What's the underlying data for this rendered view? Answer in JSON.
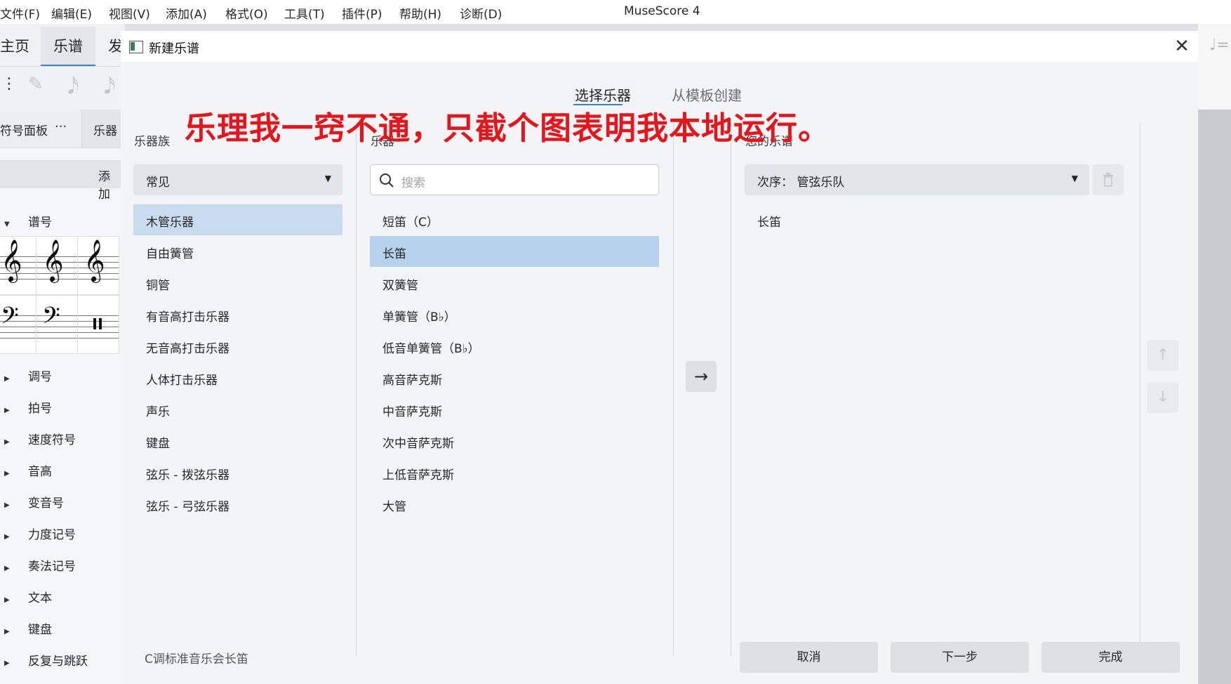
{
  "app": {
    "title": "MuseScore 4",
    "menu": [
      "文件(F)",
      "编辑(E)",
      "视图(V)",
      "添加(A)",
      "格式(O)",
      "工具(T)",
      "插件(P)",
      "帮助(H)",
      "诊断(D)"
    ]
  },
  "tabs": [
    "主页",
    "乐谱",
    "发"
  ],
  "palette": {
    "tab_label": "符号面板",
    "more": "···",
    "instruments_tab": "乐器",
    "add_label": "添加",
    "sections": [
      "谱号",
      "调号",
      "拍号",
      "速度符号",
      "音高",
      "变音号",
      "力度记号",
      "奏法记号",
      "文本",
      "键盘",
      "反复与跳跃"
    ]
  },
  "dialog": {
    "title": "新建乐谱",
    "tabs": {
      "choose": "选择乐器",
      "template": "从模板创建"
    },
    "families": {
      "label": "乐器族",
      "dropdown": "常见",
      "items": [
        "木管乐器",
        "自由簧管",
        "铜管",
        "有音高打击乐器",
        "无音高打击乐器",
        "人体打击乐器",
        "声乐",
        "键盘",
        "弦乐 - 拨弦乐器",
        "弦乐 - 弓弦乐器"
      ],
      "selected": "木管乐器"
    },
    "instruments": {
      "label": "乐器",
      "search_placeholder": "搜索",
      "items": [
        "短笛（C）",
        "长笛",
        "双簧管",
        "单簧管（B♭）",
        "低音单簧管（B♭）",
        "高音萨克斯",
        "中音萨克斯",
        "次中音萨克斯",
        "上低音萨克斯",
        "大管"
      ],
      "selected": "长笛"
    },
    "score": {
      "label": "您的乐谱",
      "order": "次序：  管弦乐队",
      "items": [
        "长笛"
      ]
    },
    "footer": {
      "description": "C调标准音乐会长笛",
      "cancel": "取消",
      "next": "下一步",
      "done": "完成"
    }
  },
  "annotation": "乐理我一窍不通，只截个图表明我本地运行。"
}
